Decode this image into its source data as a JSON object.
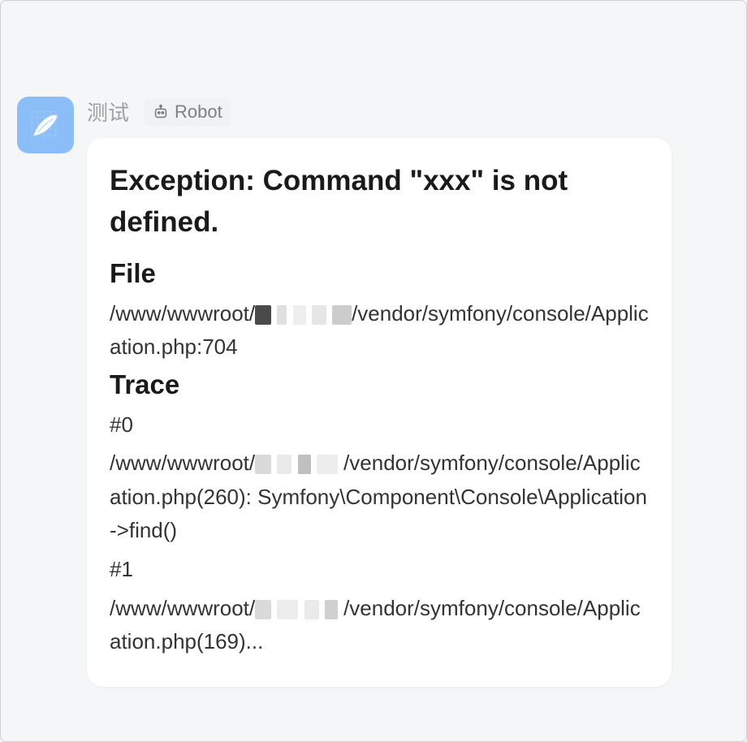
{
  "message": {
    "sender": "测试",
    "tag": "Robot"
  },
  "card": {
    "exception_title": "Exception: Command \"xxx\" is not defined.",
    "file_heading": "File",
    "file_path_pre": "/www/wwwroot/",
    "file_path_post": "/vendor/symfony/console/Application.php:704",
    "trace_heading": "Trace",
    "trace": {
      "line0_num": "#0",
      "line0_pre": "/www/wwwroot/",
      "line0_post": "/vendor/symfony/console/Application.php(260): Symfony\\Component\\Console\\Application->find()",
      "line1_num": "#1",
      "line1_pre": "/www/wwwroot/",
      "line1_post": "/vendor/symfony/console/Application.php(169)..."
    }
  }
}
